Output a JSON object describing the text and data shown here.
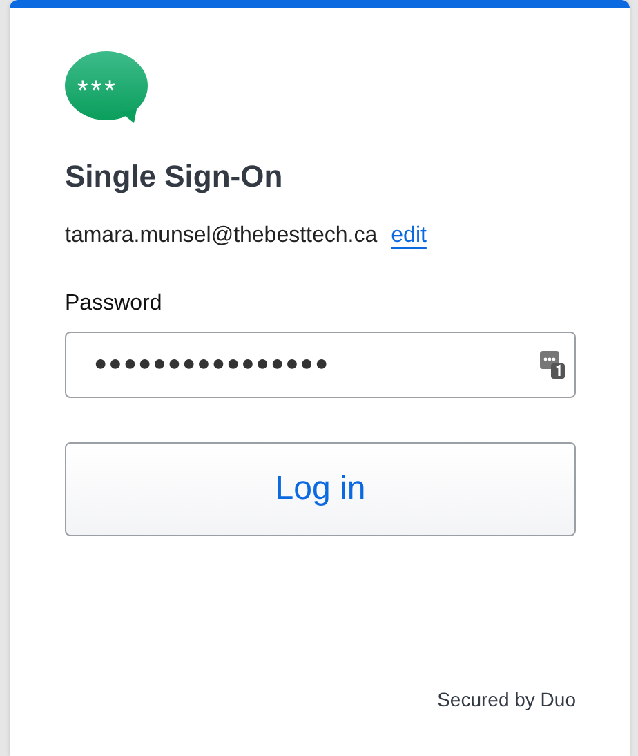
{
  "logo_text": "***",
  "title": "Single Sign-On",
  "email": "tamara.munsel@thebesttech.ca",
  "edit_link": "edit",
  "password": {
    "label": "Password",
    "value": "●●●●●●●●●●●●●●●●"
  },
  "login_button": "Log in",
  "footer": "Secured by Duo"
}
